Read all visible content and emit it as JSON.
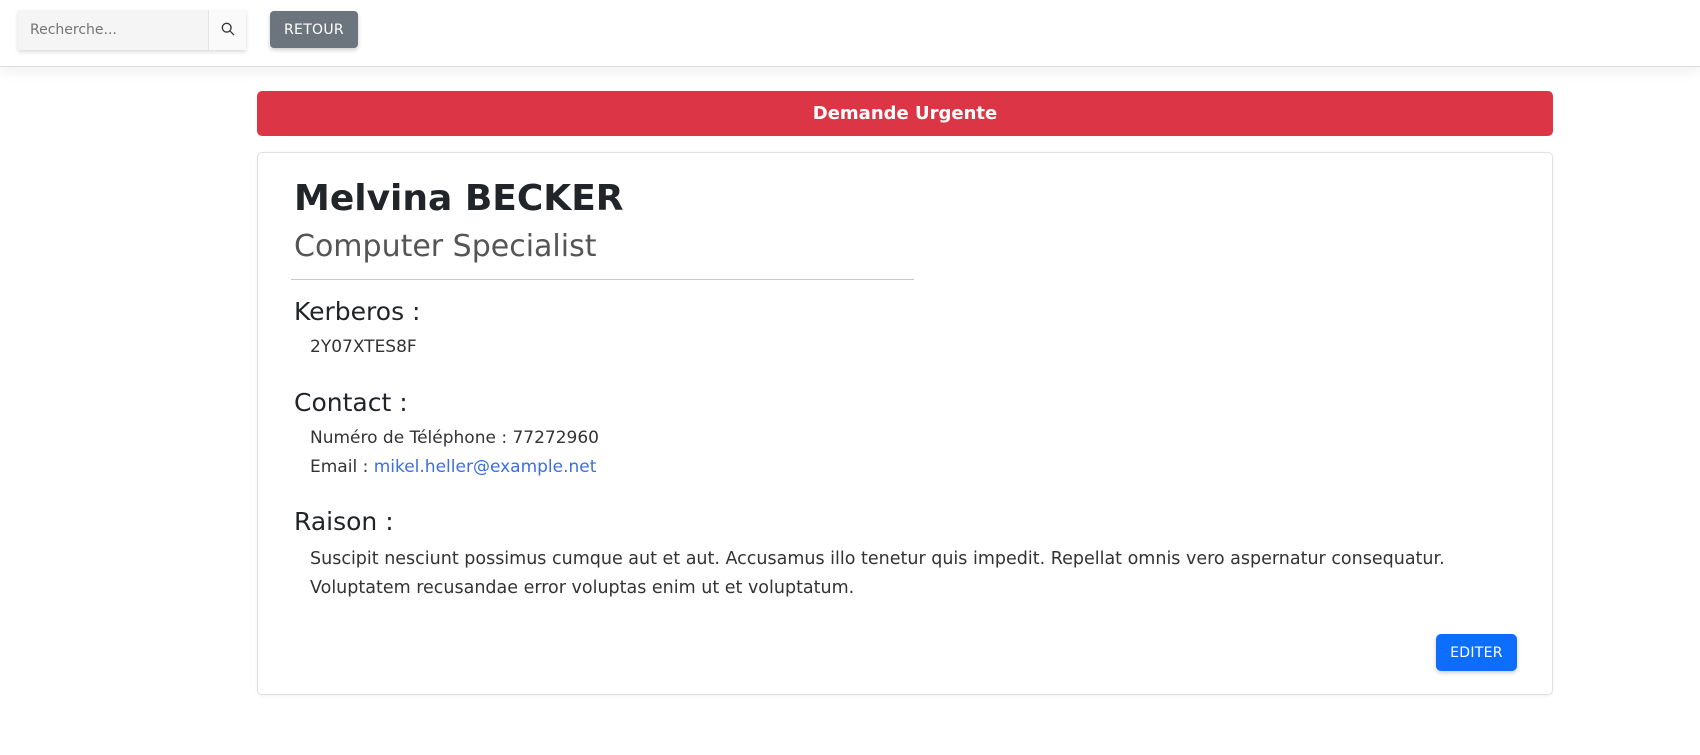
{
  "topbar": {
    "search_placeholder": "Recherche...",
    "search_icon": "search-icon",
    "back_label": "RETOUR"
  },
  "banner": {
    "text": "Demande Urgente",
    "color": "#dc3545"
  },
  "profile": {
    "name": "Melvina BECKER",
    "job_title": "Computer Specialist"
  },
  "kerberos": {
    "title": "Kerberos :",
    "value": "2Y07XTES8F"
  },
  "contact": {
    "title": "Contact :",
    "phone_label": "Numéro de Téléphone : ",
    "phone_value": "77272960",
    "email_label": "Email : ",
    "email_value": "mikel.heller@example.net"
  },
  "reason": {
    "title": "Raison :",
    "text": "Suscipit nesciunt possimus cumque aut et aut. Accusamus illo tenetur quis impedit. Repellat omnis vero aspernatur consequatur. Voluptatem recusandae error voluptas enim ut et voluptatum."
  },
  "actions": {
    "edit_label": "EDITER",
    "edit_color": "#0d6efd"
  }
}
